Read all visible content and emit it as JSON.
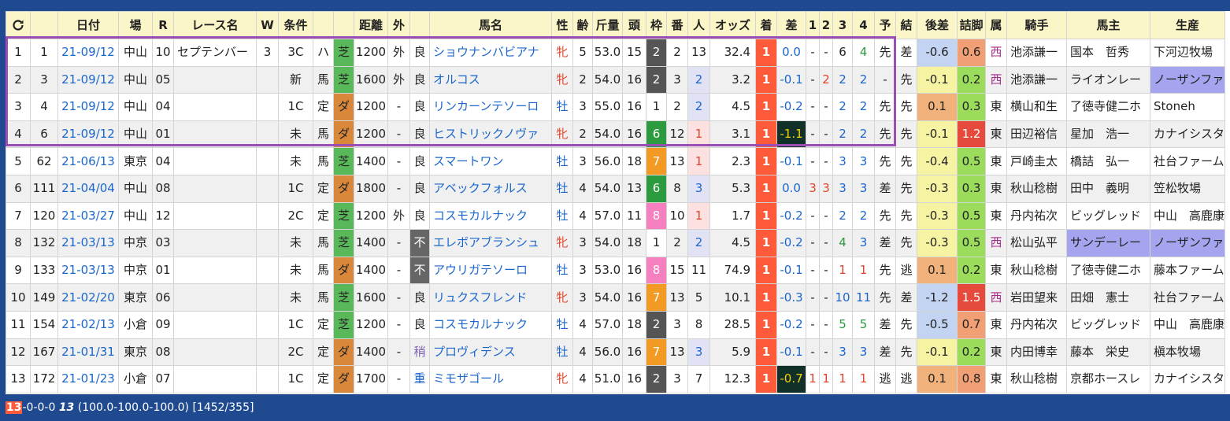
{
  "headers": [
    "",
    "日付",
    "場",
    "R",
    "レース名",
    "W",
    "条件",
    "",
    "",
    "距離",
    "外",
    "",
    "馬名",
    "性",
    "齢",
    "斤量",
    "頭",
    "枠",
    "番",
    "人",
    "オッズ",
    "着",
    "差",
    "1",
    "2",
    "3",
    "4",
    "予",
    "結",
    "後差",
    "詰脚",
    "属",
    "騎手",
    "馬主",
    "生産"
  ],
  "refresh_icon": "refresh-icon",
  "rows": [
    {
      "idx": "1",
      "no": "1",
      "date": "21-09/12",
      "place": "中山",
      "r": "10",
      "race": "セプテンバー",
      "w": "3",
      "grade": "3C",
      "cls": "ハ",
      "surface": "芝",
      "dist": "1200",
      "outer": "外",
      "cond": "良",
      "horse": "ショウナンバビアナ",
      "sex": "牝",
      "age": "5",
      "weight": "53.0",
      "heads": "15",
      "frame": "2",
      "num": "2",
      "pop": "13",
      "odds": "32.4",
      "fin": "1",
      "margin": "0.0",
      "c1": "-",
      "c2": "-",
      "c3": "6",
      "c4": "4",
      "pred": "先",
      "res": "差",
      "late": "-0.6",
      "end": "0.6",
      "belong": "西",
      "jockey": "池添謙一",
      "owner": "国本　哲秀",
      "breeder": "下河辺牧場"
    },
    {
      "idx": "2",
      "no": "3",
      "date": "21-09/12",
      "place": "中山",
      "r": "05",
      "race": "",
      "w": "",
      "grade": "新",
      "cls": "馬",
      "surface": "芝",
      "dist": "1600",
      "outer": "外",
      "cond": "良",
      "horse": "オルコス",
      "sex": "牝",
      "age": "2",
      "weight": "54.0",
      "heads": "16",
      "frame": "2",
      "num": "3",
      "pop": "2",
      "odds": "3.2",
      "fin": "1",
      "margin": "-0.1",
      "c1": "-",
      "c2": "2",
      "c3": "2",
      "c4": "2",
      "pred": "-",
      "res": "先",
      "late": "-0.1",
      "end": "0.2",
      "belong": "西",
      "jockey": "池添謙一",
      "owner": "ライオンレー",
      "breeder": "ノーザンファ"
    },
    {
      "idx": "3",
      "no": "4",
      "date": "21-09/12",
      "place": "中山",
      "r": "04",
      "race": "",
      "w": "",
      "grade": "1C",
      "cls": "定",
      "surface": "ダ",
      "dist": "1200",
      "outer": "-",
      "cond": "良",
      "horse": "リンカーンテソーロ",
      "sex": "牡",
      "age": "3",
      "weight": "55.0",
      "heads": "16",
      "frame": "1",
      "num": "2",
      "pop": "2",
      "odds": "4.5",
      "fin": "1",
      "margin": "-0.2",
      "c1": "-",
      "c2": "-",
      "c3": "2",
      "c4": "2",
      "pred": "先",
      "res": "先",
      "late": "0.1",
      "end": "0.3",
      "belong": "東",
      "jockey": "横山和生",
      "owner": "了徳寺健二ホ",
      "breeder": "Stoneh"
    },
    {
      "idx": "4",
      "no": "6",
      "date": "21-09/12",
      "place": "中山",
      "r": "01",
      "race": "",
      "w": "",
      "grade": "未",
      "cls": "馬",
      "surface": "ダ",
      "dist": "1200",
      "outer": "-",
      "cond": "良",
      "horse": "ヒストリックノヴァ",
      "sex": "牝",
      "age": "2",
      "weight": "54.0",
      "heads": "16",
      "frame": "6",
      "num": "12",
      "pop": "1",
      "odds": "3.1",
      "fin": "1",
      "margin": "-1.1",
      "c1": "-",
      "c2": "-",
      "c3": "2",
      "c4": "2",
      "pred": "先",
      "res": "先",
      "late": "-0.1",
      "end": "1.2",
      "belong": "東",
      "jockey": "田辺裕信",
      "owner": "星加　浩一",
      "breeder": "カナイシスタ"
    },
    {
      "idx": "5",
      "no": "62",
      "date": "21-06/13",
      "place": "東京",
      "r": "04",
      "race": "",
      "w": "",
      "grade": "未",
      "cls": "馬",
      "surface": "芝",
      "dist": "1400",
      "outer": "-",
      "cond": "良",
      "horse": "スマートワン",
      "sex": "牡",
      "age": "3",
      "weight": "56.0",
      "heads": "18",
      "frame": "7",
      "num": "13",
      "pop": "1",
      "odds": "2.3",
      "fin": "1",
      "margin": "-0.1",
      "c1": "-",
      "c2": "-",
      "c3": "3",
      "c4": "3",
      "pred": "先",
      "res": "先",
      "late": "-0.4",
      "end": "0.5",
      "belong": "東",
      "jockey": "戸崎圭太",
      "owner": "橋詰　弘一",
      "breeder": "社台ファーム"
    },
    {
      "idx": "6",
      "no": "111",
      "date": "21-04/04",
      "place": "中山",
      "r": "08",
      "race": "",
      "w": "",
      "grade": "1C",
      "cls": "定",
      "surface": "ダ",
      "dist": "1800",
      "outer": "-",
      "cond": "良",
      "horse": "アベックフォルス",
      "sex": "牡",
      "age": "4",
      "weight": "54.0",
      "heads": "13",
      "frame": "6",
      "num": "8",
      "pop": "3",
      "odds": "5.3",
      "fin": "1",
      "margin": "0.0",
      "c1": "3",
      "c2": "3",
      "c3": "3",
      "c4": "3",
      "pred": "差",
      "res": "先",
      "late": "-0.3",
      "end": "0.3",
      "belong": "東",
      "jockey": "秋山稔樹",
      "owner": "田中　義明",
      "breeder": "笠松牧場"
    },
    {
      "idx": "7",
      "no": "120",
      "date": "21-03/27",
      "place": "中山",
      "r": "12",
      "race": "",
      "w": "",
      "grade": "2C",
      "cls": "定",
      "surface": "芝",
      "dist": "1200",
      "outer": "外",
      "cond": "良",
      "horse": "コスモカルナック",
      "sex": "牡",
      "age": "4",
      "weight": "57.0",
      "heads": "11",
      "frame": "8",
      "num": "10",
      "pop": "1",
      "odds": "1.7",
      "fin": "1",
      "margin": "-0.2",
      "c1": "-",
      "c2": "-",
      "c3": "2",
      "c4": "2",
      "pred": "先",
      "res": "先",
      "late": "-0.3",
      "end": "0.5",
      "belong": "東",
      "jockey": "丹内祐次",
      "owner": "ビッグレッド",
      "breeder": "中山　高鹿康"
    },
    {
      "idx": "8",
      "no": "132",
      "date": "21-03/13",
      "place": "中京",
      "r": "03",
      "race": "",
      "w": "",
      "grade": "未",
      "cls": "馬",
      "surface": "芝",
      "dist": "1400",
      "outer": "-",
      "cond": "不",
      "horse": "エレボアブランシュ",
      "sex": "牝",
      "age": "3",
      "weight": "54.0",
      "heads": "18",
      "frame": "1",
      "num": "2",
      "pop": "2",
      "odds": "4.5",
      "fin": "1",
      "margin": "-0.2",
      "c1": "-",
      "c2": "-",
      "c3": "4",
      "c4": "3",
      "pred": "差",
      "res": "先",
      "late": "-0.3",
      "end": "0.5",
      "belong": "西",
      "jockey": "松山弘平",
      "owner": "サンデーレー",
      "breeder": "ノーザンファ"
    },
    {
      "idx": "9",
      "no": "133",
      "date": "21-03/13",
      "place": "中京",
      "r": "01",
      "race": "",
      "w": "",
      "grade": "未",
      "cls": "馬",
      "surface": "ダ",
      "dist": "1400",
      "outer": "-",
      "cond": "不",
      "horse": "アウリガテソーロ",
      "sex": "牡",
      "age": "3",
      "weight": "53.0",
      "heads": "16",
      "frame": "8",
      "num": "15",
      "pop": "11",
      "odds": "74.9",
      "fin": "1",
      "margin": "-0.1",
      "c1": "-",
      "c2": "-",
      "c3": "1",
      "c4": "1",
      "pred": "先",
      "res": "逃",
      "late": "0.1",
      "end": "0.2",
      "belong": "東",
      "jockey": "秋山稔樹",
      "owner": "了徳寺健二ホ",
      "breeder": "藤本ファーム"
    },
    {
      "idx": "10",
      "no": "149",
      "date": "21-02/20",
      "place": "東京",
      "r": "06",
      "race": "",
      "w": "",
      "grade": "未",
      "cls": "馬",
      "surface": "芝",
      "dist": "1600",
      "outer": "-",
      "cond": "良",
      "horse": "リュクスフレンド",
      "sex": "牝",
      "age": "3",
      "weight": "54.0",
      "heads": "16",
      "frame": "7",
      "num": "13",
      "pop": "5",
      "odds": "10.1",
      "fin": "1",
      "margin": "-0.3",
      "c1": "-",
      "c2": "-",
      "c3": "10",
      "c4": "11",
      "pred": "先",
      "res": "差",
      "late": "-1.2",
      "end": "1.5",
      "belong": "西",
      "jockey": "岩田望来",
      "owner": "田畑　憲士",
      "breeder": "社台ファーム"
    },
    {
      "idx": "11",
      "no": "154",
      "date": "21-02/13",
      "place": "小倉",
      "r": "09",
      "race": "",
      "w": "",
      "grade": "1C",
      "cls": "定",
      "surface": "芝",
      "dist": "1200",
      "outer": "-",
      "cond": "良",
      "horse": "コスモカルナック",
      "sex": "牡",
      "age": "4",
      "weight": "57.0",
      "heads": "18",
      "frame": "2",
      "num": "3",
      "pop": "8",
      "odds": "28.5",
      "fin": "1",
      "margin": "-0.2",
      "c1": "-",
      "c2": "-",
      "c3": "5",
      "c4": "5",
      "pred": "差",
      "res": "先",
      "late": "-0.5",
      "end": "0.7",
      "belong": "東",
      "jockey": "丹内祐次",
      "owner": "ビッグレッド",
      "breeder": "中山　高鹿康"
    },
    {
      "idx": "12",
      "no": "167",
      "date": "21-01/31",
      "place": "東京",
      "r": "08",
      "race": "",
      "w": "",
      "grade": "2C",
      "cls": "定",
      "surface": "ダ",
      "dist": "1400",
      "outer": "-",
      "cond": "稍",
      "horse": "プロヴィデンス",
      "sex": "牡",
      "age": "4",
      "weight": "56.0",
      "heads": "16",
      "frame": "7",
      "num": "13",
      "pop": "3",
      "odds": "5.9",
      "fin": "1",
      "margin": "-0.1",
      "c1": "-",
      "c2": "-",
      "c3": "3",
      "c4": "3",
      "pred": "差",
      "res": "先",
      "late": "-0.1",
      "end": "0.2",
      "belong": "東",
      "jockey": "内田博幸",
      "owner": "藤本　栄史",
      "breeder": "槇本牧場"
    },
    {
      "idx": "13",
      "no": "172",
      "date": "21-01/23",
      "place": "小倉",
      "r": "07",
      "race": "",
      "w": "",
      "grade": "1C",
      "cls": "定",
      "surface": "ダ",
      "dist": "1700",
      "outer": "-",
      "cond": "重",
      "horse": "ミモザゴール",
      "sex": "牝",
      "age": "4",
      "weight": "51.0",
      "heads": "16",
      "frame": "2",
      "num": "3",
      "pop": "7",
      "odds": "12.3",
      "fin": "1",
      "margin": "-0.7",
      "c1": "1",
      "c2": "1",
      "c3": "1",
      "c4": "1",
      "pred": "逃",
      "res": "逃",
      "late": "0.1",
      "end": "0.8",
      "belong": "東",
      "jockey": "秋山稔樹",
      "owner": "京都ホースレ",
      "breeder": "カナイシスタ"
    }
  ],
  "status": {
    "badge": "13",
    "record": "-0-0-0 ",
    "total": "13",
    "rest": " (100.0-100.0-100.0) [1452/355]"
  }
}
